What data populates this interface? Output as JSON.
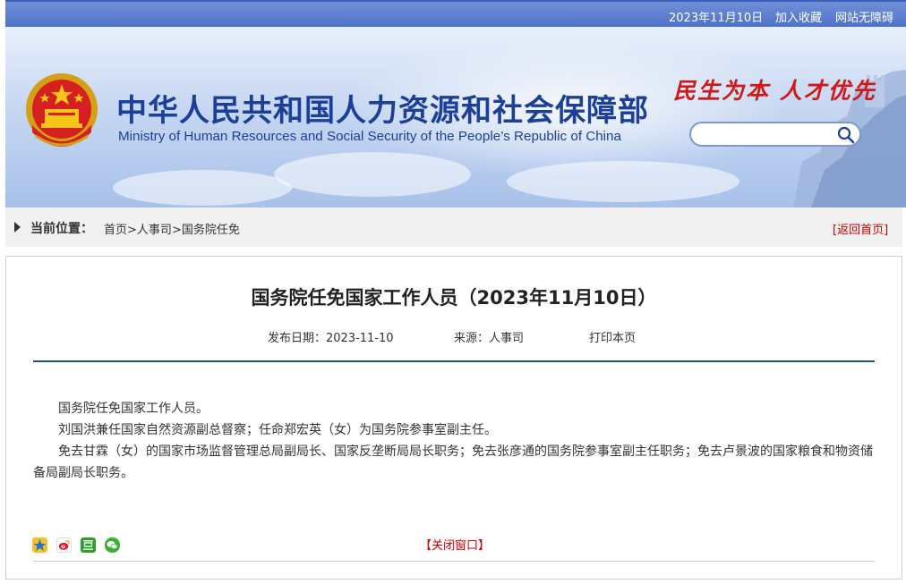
{
  "topbar": {
    "date": "2023年11月10日",
    "add_favorite": "加入收藏",
    "accessibility": "网站无障碍"
  },
  "header": {
    "title_cn": "中华人民共和国人力资源和社会保障部",
    "title_en": "Ministry of Human Resources and Social Security of the People’s Republic of China",
    "slogan": "民生为本 人才优先",
    "search_placeholder": ""
  },
  "breadcrumb": {
    "label": "当前位置：",
    "items": [
      "首页",
      "人事司",
      "国务院任免"
    ],
    "separator": ">",
    "back_home": "[返回首页]"
  },
  "article": {
    "title": "国务院任免国家工作人员（2023年11月10日）",
    "publish_date": "发布日期：2023-11-10",
    "source": "来源：人事司",
    "print": "打印本页",
    "paragraphs": [
      "国务院任免国家工作人员。",
      "刘国洪兼任国家自然资源副总督察；任命郑宏英（女）为国务院参事室副主任。",
      "免去甘霖（女）的国家市场监督管理总局副局长、国家反垄断局局长职务；免去张彦通的国务院参事室副主任职务；免去卢景波的国家粮食和物资储备局副局长职务。"
    ],
    "close_window": "【关闭窗口】",
    "share_icons": [
      "qzone-icon",
      "weibo-icon",
      "douban-icon",
      "wechat-icon"
    ]
  },
  "colors": {
    "brand_blue": "#1c3f98",
    "accent_red": "#cc0000",
    "rule_blue": "#1f4d8c"
  }
}
